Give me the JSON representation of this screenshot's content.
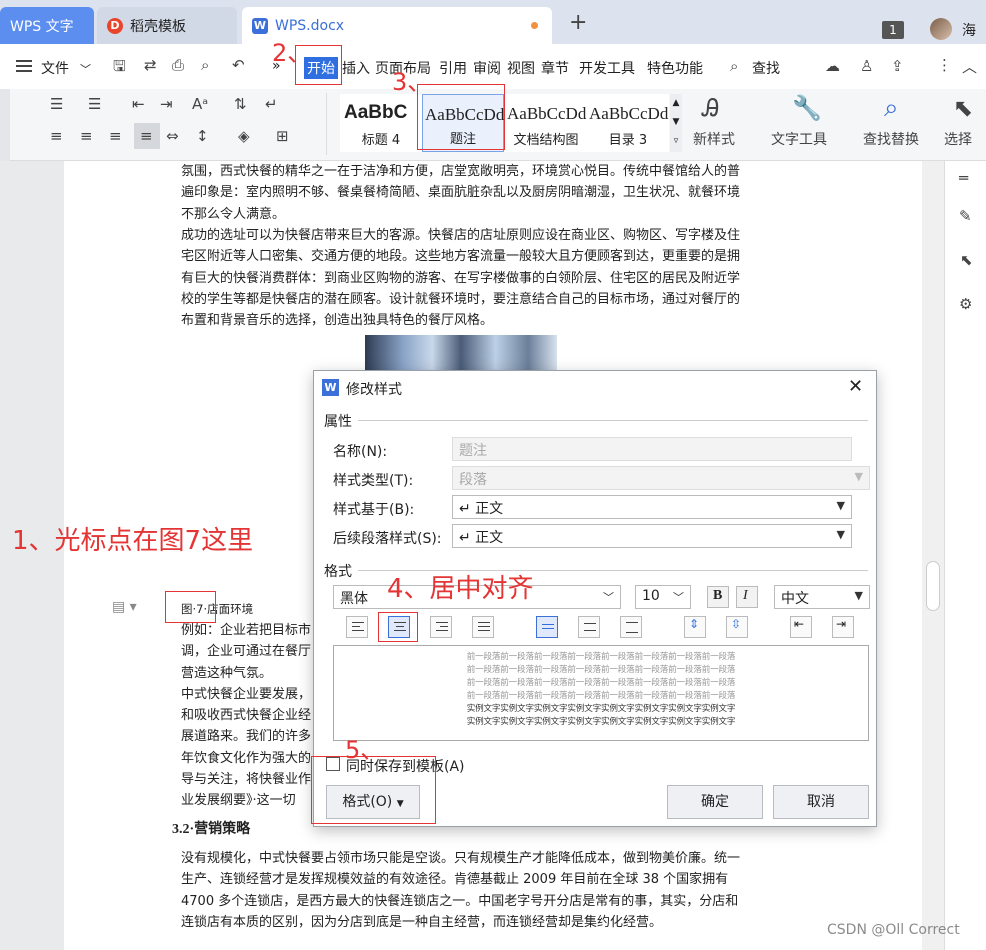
{
  "tabs": {
    "home": "WPS 文字",
    "template": "稻壳模板",
    "doc": "WPS.docx",
    "new": "+",
    "badge": "1",
    "user": "海"
  },
  "menu": {
    "file": "文件",
    "overflow": "»",
    "start": "开始",
    "insert": "插入",
    "layout": "页面布局",
    "ref": "引用",
    "review": "审阅",
    "view": "视图",
    "chapter": "章节",
    "dev": "开发工具",
    "special": "特色功能",
    "search": "查找"
  },
  "ribbon": {
    "styles": [
      {
        "preview": "AaBbC",
        "label": "标题 4"
      },
      {
        "preview": "AaBbCcDd",
        "label": "题注"
      },
      {
        "preview": "AaBbCcDd",
        "label": "文档结构图"
      },
      {
        "preview": "AaBbCcDd",
        "label": "目录 3"
      }
    ],
    "new_style": "新样式",
    "text_tools": "文字工具",
    "find_replace": "查找替换",
    "select": "选择"
  },
  "doc": {
    "p1": "氛围，西式快餐的精华之一在于洁净和方便，店堂宽敞明亮，环境赏心悦目。传统中餐馆给人的普遍印象是：室内照明不够、餐桌餐椅简陋、桌面肮脏杂乱以及厨房阴暗潮湿，卫生状况、就餐环境不那么令人满意。",
    "p2": "成功的选址可以为快餐店带来巨大的客源。快餐店的店址原则应设在商业区、购物区、写字楼及住宅区附近等人口密集、交通方便的地段。这些地方客流量一般较大且方便顾客到达，更重要的是拥有巨大的快餐消费群体：到商业区购物的游客、在写字楼做事的白领阶层、住宅区的居民及附近学校的学生等都是快餐店的潜在顾客。设计就餐环境时，要注意结合自己的目标市场，通过对餐厅的布置和背景音乐的选择，创造出独具特色的餐厅风格。",
    "caption": "图·7·店面环境",
    "left_lines": [
      "例如：企业若把目标市",
      "调，企业可通过在餐厅",
      "营造这种气氛。",
      "中式快餐企业要发展，",
      "和吸收西式快餐企业经",
      "展道路来。我们的许多",
      "年饮食文化作为强大的",
      "导与关注，将快餐业作",
      "业发展纲要》·这一切"
    ],
    "heading": "3.2·营销策略",
    "p3": "没有规模化，中式快餐要占领市场只能是空谈。只有规模生产才能降低成本，做到物美价廉。统一生产、连锁经营才是发挥规模效益的有效途径。肯德基截止 2009 年目前在全球 38 个国家拥有 4700 多个连锁店，是西方最大的快餐连锁店之一。中国老字号开分店是常有的事，其实，分店和连锁店有本质的区别，因为分店到底是一种自主经营，而连锁经营却是集约化经营。"
  },
  "dialog": {
    "title": "修改样式",
    "section_props": "属性",
    "name_label": "名称(N):",
    "name_value": "题注",
    "type_label": "样式类型(T):",
    "type_value": "段落",
    "based_label": "样式基于(B):",
    "based_value": "↵ 正文",
    "next_label": "后续段落样式(S):",
    "next_value": "↵ 正文",
    "section_format": "格式",
    "font": "黑体",
    "size": "10",
    "bold": "B",
    "italic": "I",
    "lang": "中文",
    "preview_prev": [
      "前一段落前一段落前一段落前一段落前一段落前一段落前一段落前一段落",
      "前一段落前一段落前一段落前一段落前一段落前一段落前一段落前一段落",
      "前一段落前一段落前一段落前一段落前一段落前一段落前一段落前一段落",
      "前一段落前一段落前一段落前一段落前一段落前一段落前一段落前一段落"
    ],
    "preview_sample": [
      "实例文字实例文字实例文字实例文字实例文字实例文字实例文字实例文字",
      "实例文字实例文字实例文字实例文字实例文字实例文字实例文字实例文字"
    ],
    "save_template": "同时保存到模板(A)",
    "format_btn": "格式(O)",
    "ok": "确定",
    "cancel": "取消"
  },
  "annotations": {
    "a1": "1、光标点在图7这里",
    "a2": "2、",
    "a3": "3、",
    "a4": "4、居中对齐",
    "a5": "5、"
  },
  "watermark": "CSDN @Oll Correct",
  "colors": {
    "accent": "#2f6fe0",
    "annotation": "#e43434",
    "tab_blue": "#5c8ef0"
  }
}
